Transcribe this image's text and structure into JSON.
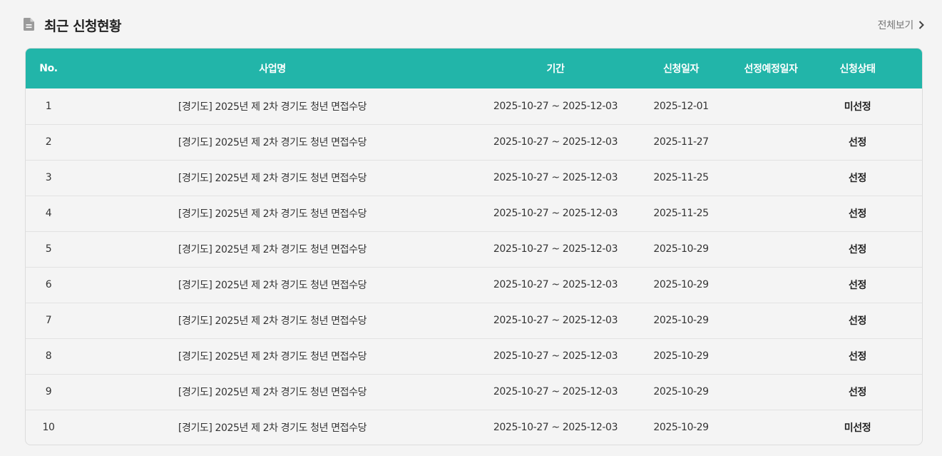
{
  "header": {
    "title": "최근 신청현황",
    "view_all": "전체보기"
  },
  "colors": {
    "accent": "#22b5a9"
  },
  "table": {
    "columns": [
      "No.",
      "사업명",
      "기간",
      "신청일자",
      "선정예정일자",
      "신청상태"
    ],
    "rows": [
      {
        "no": "1",
        "name": "[경기도] 2025년 제 2차 경기도 청년 면접수당",
        "period": "2025-10-27 ~ 2025-12-03",
        "applied": "2025-12-01",
        "expected": "",
        "status": "미선정"
      },
      {
        "no": "2",
        "name": "[경기도] 2025년 제 2차 경기도 청년 면접수당",
        "period": "2025-10-27 ~ 2025-12-03",
        "applied": "2025-11-27",
        "expected": "",
        "status": "선정"
      },
      {
        "no": "3",
        "name": "[경기도] 2025년 제 2차 경기도 청년 면접수당",
        "period": "2025-10-27 ~ 2025-12-03",
        "applied": "2025-11-25",
        "expected": "",
        "status": "선정"
      },
      {
        "no": "4",
        "name": "[경기도] 2025년 제 2차 경기도 청년 면접수당",
        "period": "2025-10-27 ~ 2025-12-03",
        "applied": "2025-11-25",
        "expected": "",
        "status": "선정"
      },
      {
        "no": "5",
        "name": "[경기도] 2025년 제 2차 경기도 청년 면접수당",
        "period": "2025-10-27 ~ 2025-12-03",
        "applied": "2025-10-29",
        "expected": "",
        "status": "선정"
      },
      {
        "no": "6",
        "name": "[경기도] 2025년 제 2차 경기도 청년 면접수당",
        "period": "2025-10-27 ~ 2025-12-03",
        "applied": "2025-10-29",
        "expected": "",
        "status": "선정"
      },
      {
        "no": "7",
        "name": "[경기도] 2025년 제 2차 경기도 청년 면접수당",
        "period": "2025-10-27 ~ 2025-12-03",
        "applied": "2025-10-29",
        "expected": "",
        "status": "선정"
      },
      {
        "no": "8",
        "name": "[경기도] 2025년 제 2차 경기도 청년 면접수당",
        "period": "2025-10-27 ~ 2025-12-03",
        "applied": "2025-10-29",
        "expected": "",
        "status": "선정"
      },
      {
        "no": "9",
        "name": "[경기도] 2025년 제 2차 경기도 청년 면접수당",
        "period": "2025-10-27 ~ 2025-12-03",
        "applied": "2025-10-29",
        "expected": "",
        "status": "선정"
      },
      {
        "no": "10",
        "name": "[경기도] 2025년 제 2차 경기도 청년 면접수당",
        "period": "2025-10-27 ~ 2025-12-03",
        "applied": "2025-10-29",
        "expected": "",
        "status": "미선정"
      }
    ]
  }
}
